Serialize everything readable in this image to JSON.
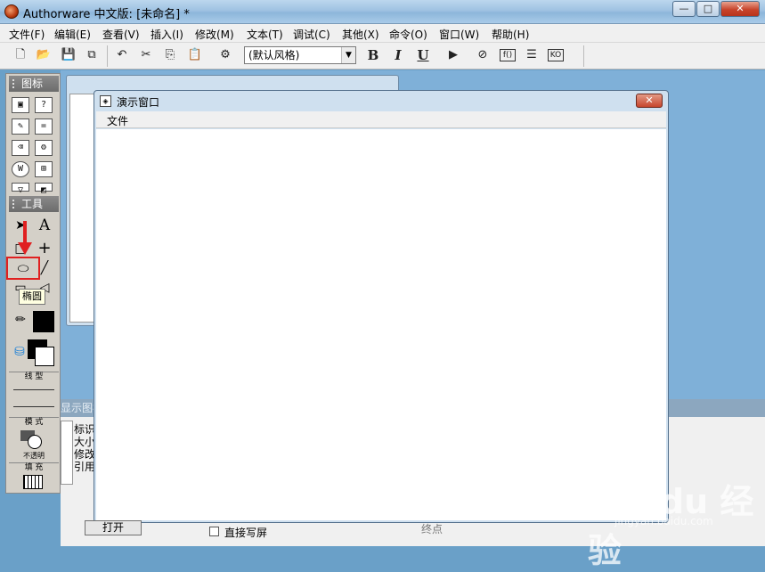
{
  "window": {
    "title": "Authorware 中文版: [未命名] *",
    "min": "—",
    "max": "□",
    "close": "✕"
  },
  "menu": [
    "文件(F)",
    "编辑(E)",
    "查看(V)",
    "插入(I)",
    "修改(M)",
    "文本(T)",
    "调试(C)",
    "其他(X)",
    "命令(O)",
    "窗口(W)",
    "帮助(H)"
  ],
  "toolbar": {
    "style_select_value": "(默认风格)",
    "bold": "B",
    "italic": "I",
    "underline": "U"
  },
  "icon_palette": {
    "title": "图标"
  },
  "tools_palette": {
    "title": "工具",
    "line_section": "线 型",
    "mode_section": "模 式",
    "mode_value": "不透明",
    "fill_section": "填 充"
  },
  "tooltip": "椭圆",
  "presentation_window": {
    "title": "演示窗口",
    "menu_file": "文件"
  },
  "properties": {
    "header": "显示图标",
    "labels": [
      "标识",
      "大小",
      "修改",
      "引用"
    ]
  },
  "bottom": {
    "open_button": "打开",
    "direct_write": "直接写屏",
    "end_label": "终点"
  },
  "watermark": "Bai du 经验",
  "watermark_sub": "jingyan.baidu.com",
  "colors": {
    "highlight": "#e02020",
    "desktop": "#7fb0d8"
  }
}
